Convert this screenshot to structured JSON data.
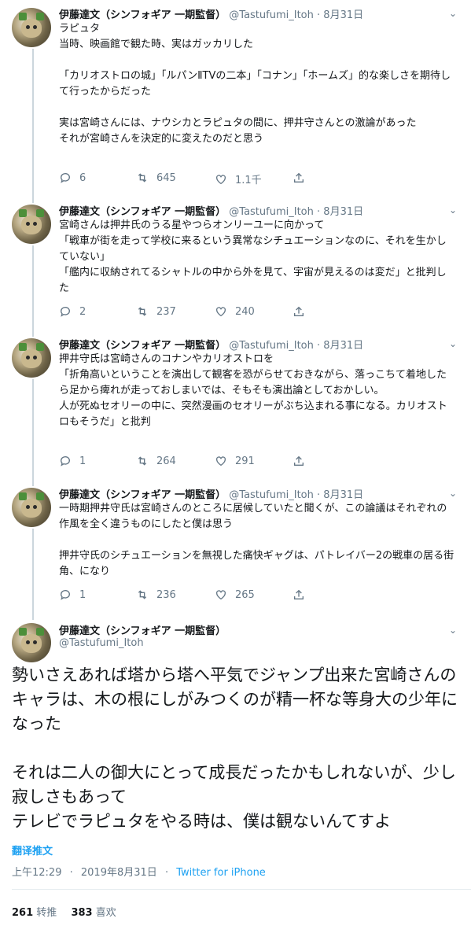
{
  "author": {
    "name": "伊藤達文（シンフォギア 一期監督）",
    "handle": "@Tastufumi_Itoh"
  },
  "separator": "·",
  "tweets": [
    {
      "date": "8月31日",
      "text": "ラピュタ\n当時、映画館で観た時、実はガッカリした\n\n「カリオストロの城」「ルパンⅡTVの二本」「コナン」「ホームズ」的な楽しさを期待して行ったからだった\n\n実は宮崎さんには、ナウシカとラピュタの間に、押井守さんとの激論があった\nそれが宮崎さんを決定的に変えたのだと思う",
      "replies": "6",
      "retweets": "645",
      "likes": "1.1千"
    },
    {
      "date": "8月31日",
      "text": "宮崎さんは押井氏のうる星やつらオンリーユーに向かって\n「戦車が街を走って学校に来るという異常なシチュエーションなのに、それを生かしていない」\n「艦内に収納されてるシャトルの中から外を見て、宇宙が見えるのは変だ」と批判した",
      "replies": "2",
      "retweets": "237",
      "likes": "240"
    },
    {
      "date": "8月31日",
      "text": "押井守氏は宮崎さんのコナンやカリオストロを\n「折角高いということを演出して観客を恐がらせておきながら、落っこちて着地したら足から痺れが走っておしまいでは、そもそも演出論としておかしい。\n人が死ぬセオリーの中に、突然漫画のセオリーがぶち込まれる事になる。カリオストロもそうだ」と批判",
      "replies": "1",
      "retweets": "264",
      "likes": "291"
    },
    {
      "date": "8月31日",
      "text": "一時期押井守氏は宮崎さんのところに居候していたと聞くが、この論議はそれぞれの作風を全く違うものにしたと僕は思う\n\n押井守氏のシチュエーションを無視した痛快ギャグは、パトレイバー2の戦車の居る街角、になり",
      "replies": "1",
      "retweets": "236",
      "likes": "265"
    }
  ],
  "main_tweet": {
    "text": "勢いさえあれば塔から塔へ平気でジャンプ出来た宮崎さんのキャラは、木の根にしがみつくのが精一杯な等身大の少年になった\n\nそれは二人の御大にとって成長だったかもしれないが、少し寂しさもあって\nテレビでラピュタをやる時は、僕は観ないんてすよ",
    "translate_label": "翻译推文",
    "time": "上午12:29",
    "date": "2019年8月31日",
    "source": "Twitter for iPhone",
    "retweet_count": "261",
    "retweet_label": "转推",
    "like_count": "383",
    "like_label": "喜欢"
  },
  "icons": {
    "reply": "reply-icon",
    "retweet": "retweet-icon",
    "like": "heart-icon",
    "share": "share-icon",
    "more": "chevron-down-icon"
  },
  "colors": {
    "link": "#1da1f2",
    "muted": "#657786",
    "text": "#14171a",
    "thread": "#ccd6dd"
  }
}
